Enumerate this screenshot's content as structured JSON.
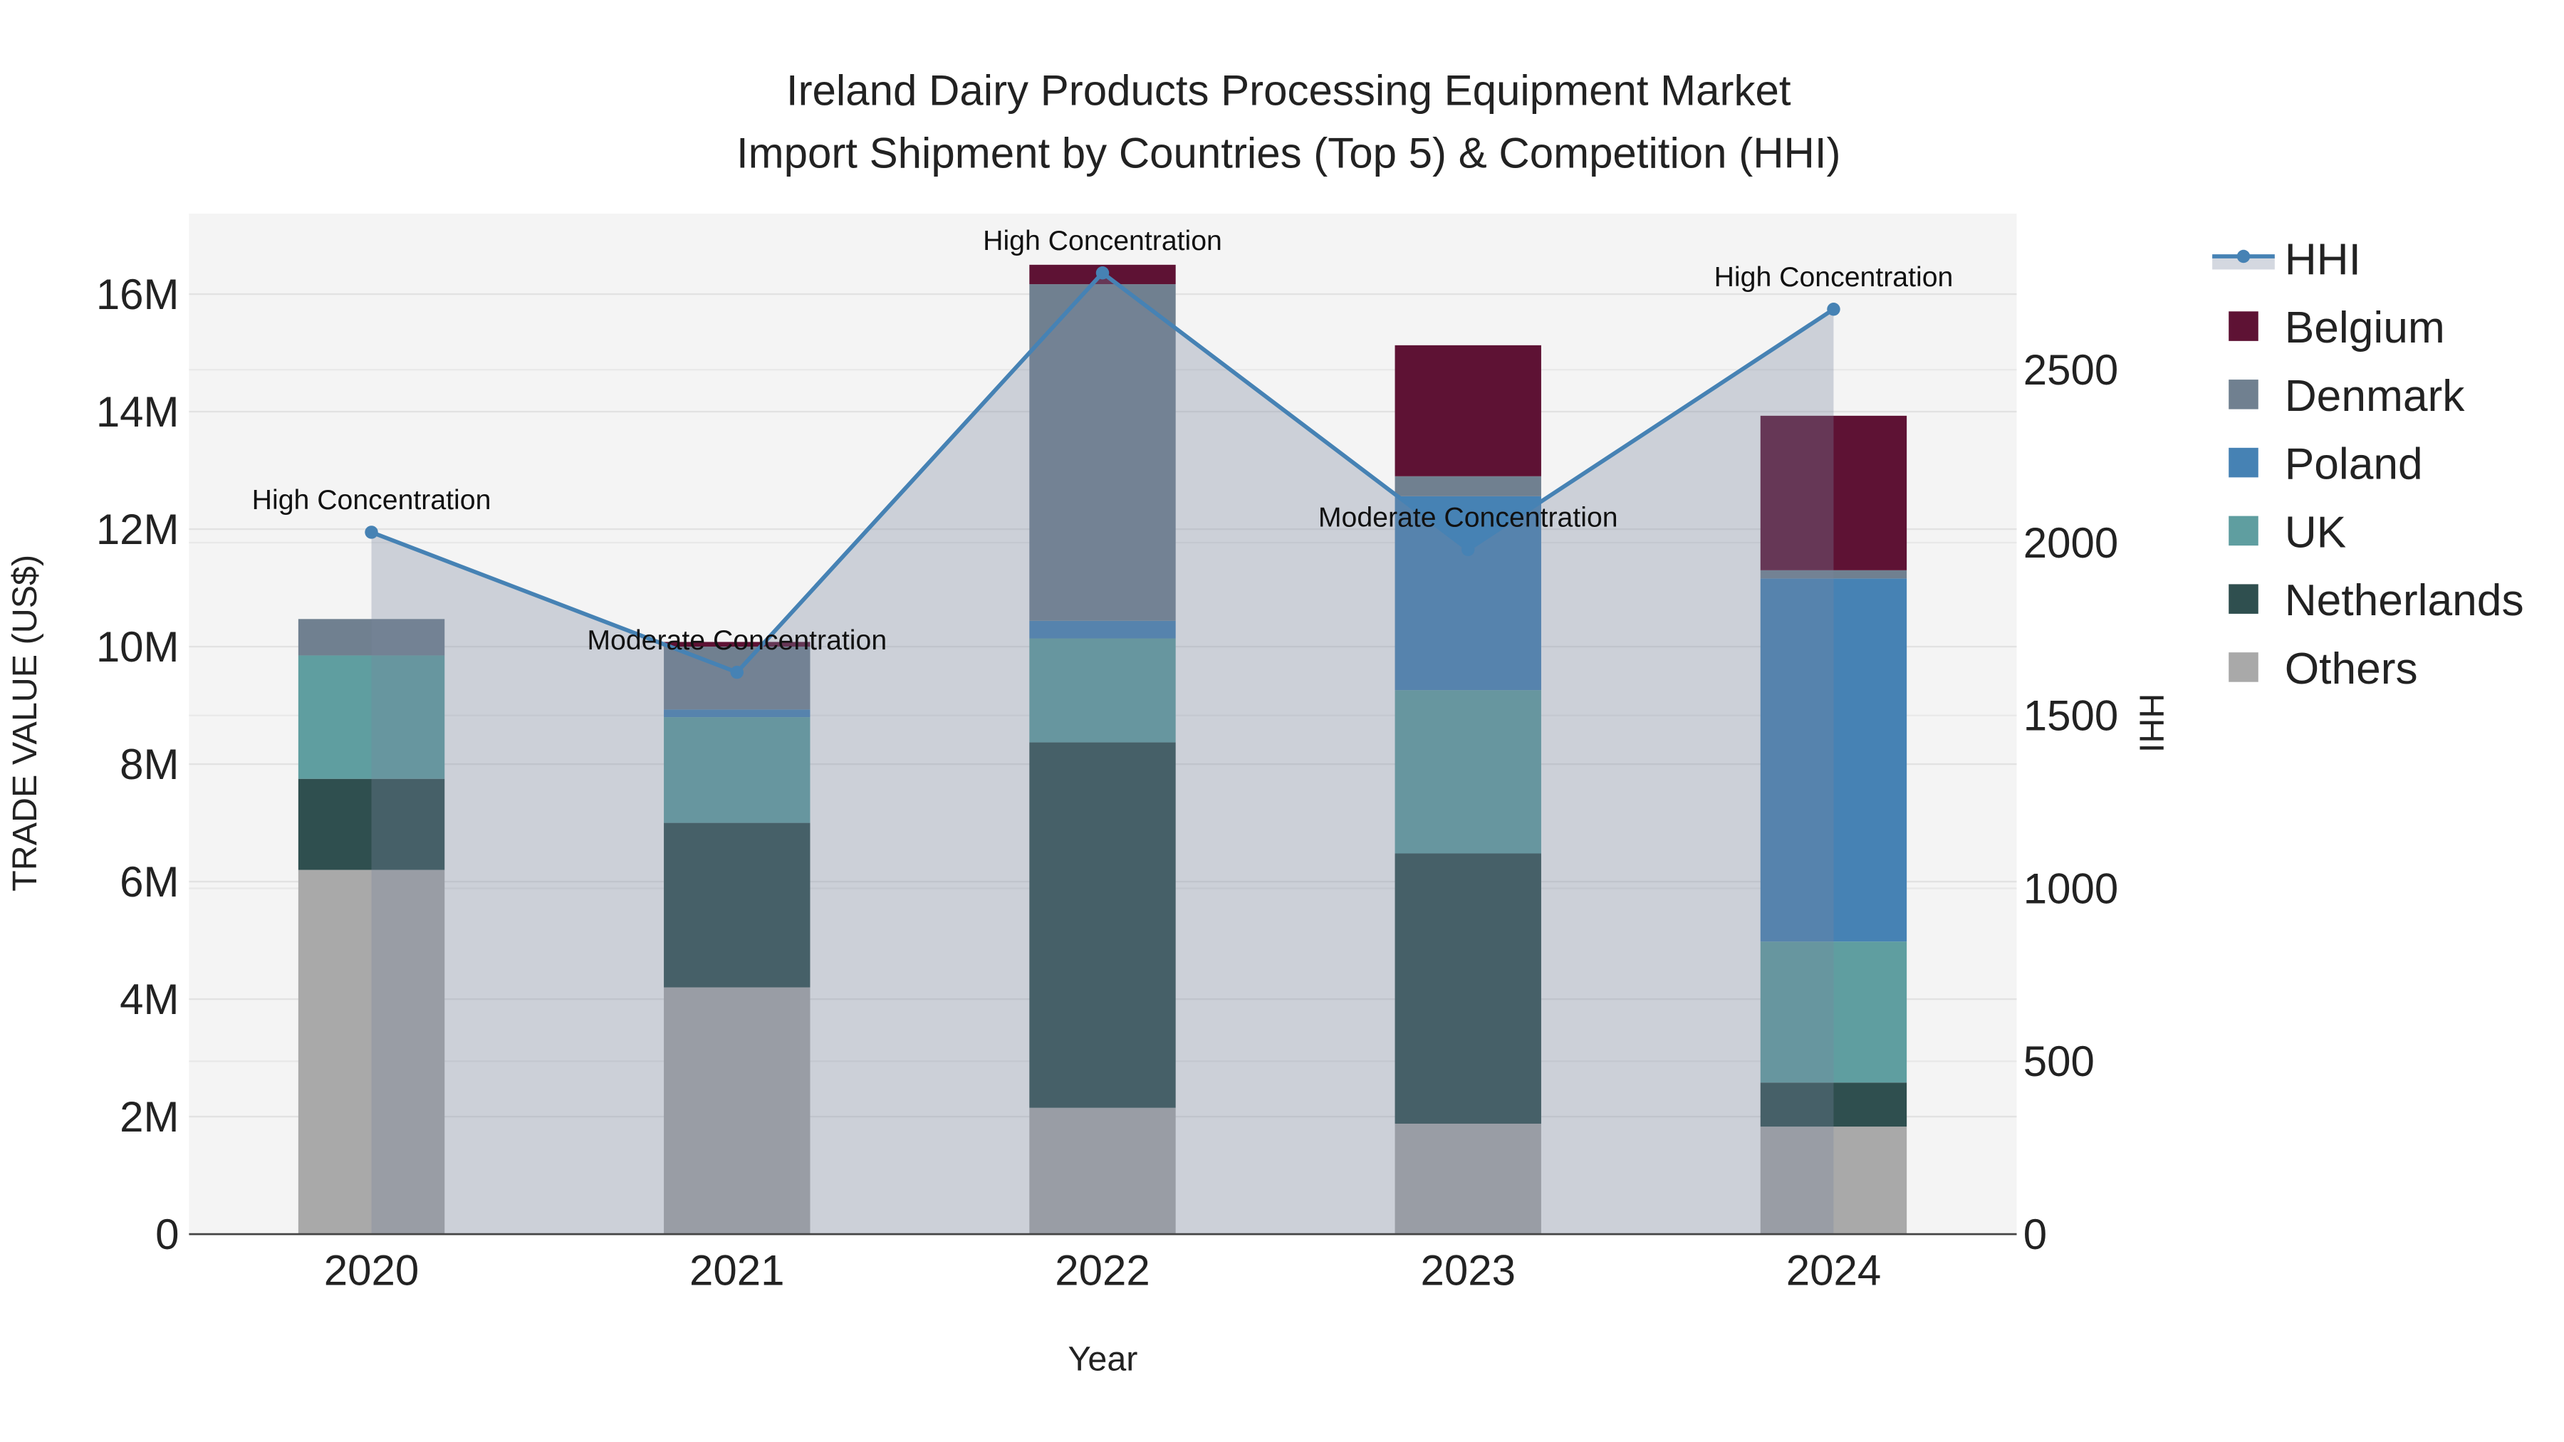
{
  "chart_data": {
    "type": "bar",
    "title_line1": "Ireland Dairy Products Processing Equipment Market",
    "title_line2": "Import Shipment by Countries (Top 5) & Competition (HHI)",
    "xlabel": "Year",
    "ylabel": "TRADE VALUE (US$)",
    "y2label": "HHI",
    "categories": [
      "2020",
      "2021",
      "2022",
      "2023",
      "2024"
    ],
    "ylim": [
      0,
      16.5
    ],
    "y_ticks": [
      0,
      2,
      4,
      6,
      8,
      10,
      12,
      14,
      16
    ],
    "y_tick_labels": [
      "0",
      "2M",
      "4M",
      "6M",
      "8M",
      "10M",
      "12M",
      "14M",
      "16M"
    ],
    "y2lim": [
      0,
      2800
    ],
    "y2_ticks": [
      0,
      500,
      1000,
      1500,
      2000,
      2500
    ],
    "y2_tick_labels": [
      "0",
      "500",
      "1000",
      "1500",
      "2000",
      "2500"
    ],
    "units": "million US$",
    "series": [
      {
        "name": "Others",
        "color": "#a9a9a9",
        "values": [
          6.2,
          4.2,
          2.15,
          1.88,
          1.83
        ]
      },
      {
        "name": "Netherlands",
        "color": "#2f4f4f",
        "values": [
          1.55,
          2.8,
          6.22,
          4.6,
          0.75
        ]
      },
      {
        "name": "UK",
        "color": "#5f9ea0",
        "values": [
          2.1,
          1.8,
          1.77,
          2.78,
          2.4
        ]
      },
      {
        "name": "Poland",
        "color": "#4682b4",
        "values": [
          0.0,
          0.13,
          0.3,
          3.3,
          6.18
        ]
      },
      {
        "name": "Denmark",
        "color": "#708090",
        "values": [
          0.62,
          1.07,
          5.73,
          0.34,
          0.14
        ]
      },
      {
        "name": "Belgium",
        "color": "#5e1234",
        "values": [
          0.0,
          0.08,
          0.33,
          2.23,
          2.63
        ]
      }
    ],
    "hhi": {
      "name": "HHI",
      "color": "#4682b4",
      "values": [
        2030,
        1625,
        2780,
        1980,
        2675
      ],
      "annotations": [
        "High Concentration",
        "Moderate Concentration",
        "High Concentration",
        "Moderate Concentration",
        "High Concentration"
      ]
    },
    "legend_order": [
      "HHI",
      "Belgium",
      "Denmark",
      "Poland",
      "UK",
      "Netherlands",
      "Others"
    ],
    "legend_position": "right",
    "grid": true
  }
}
